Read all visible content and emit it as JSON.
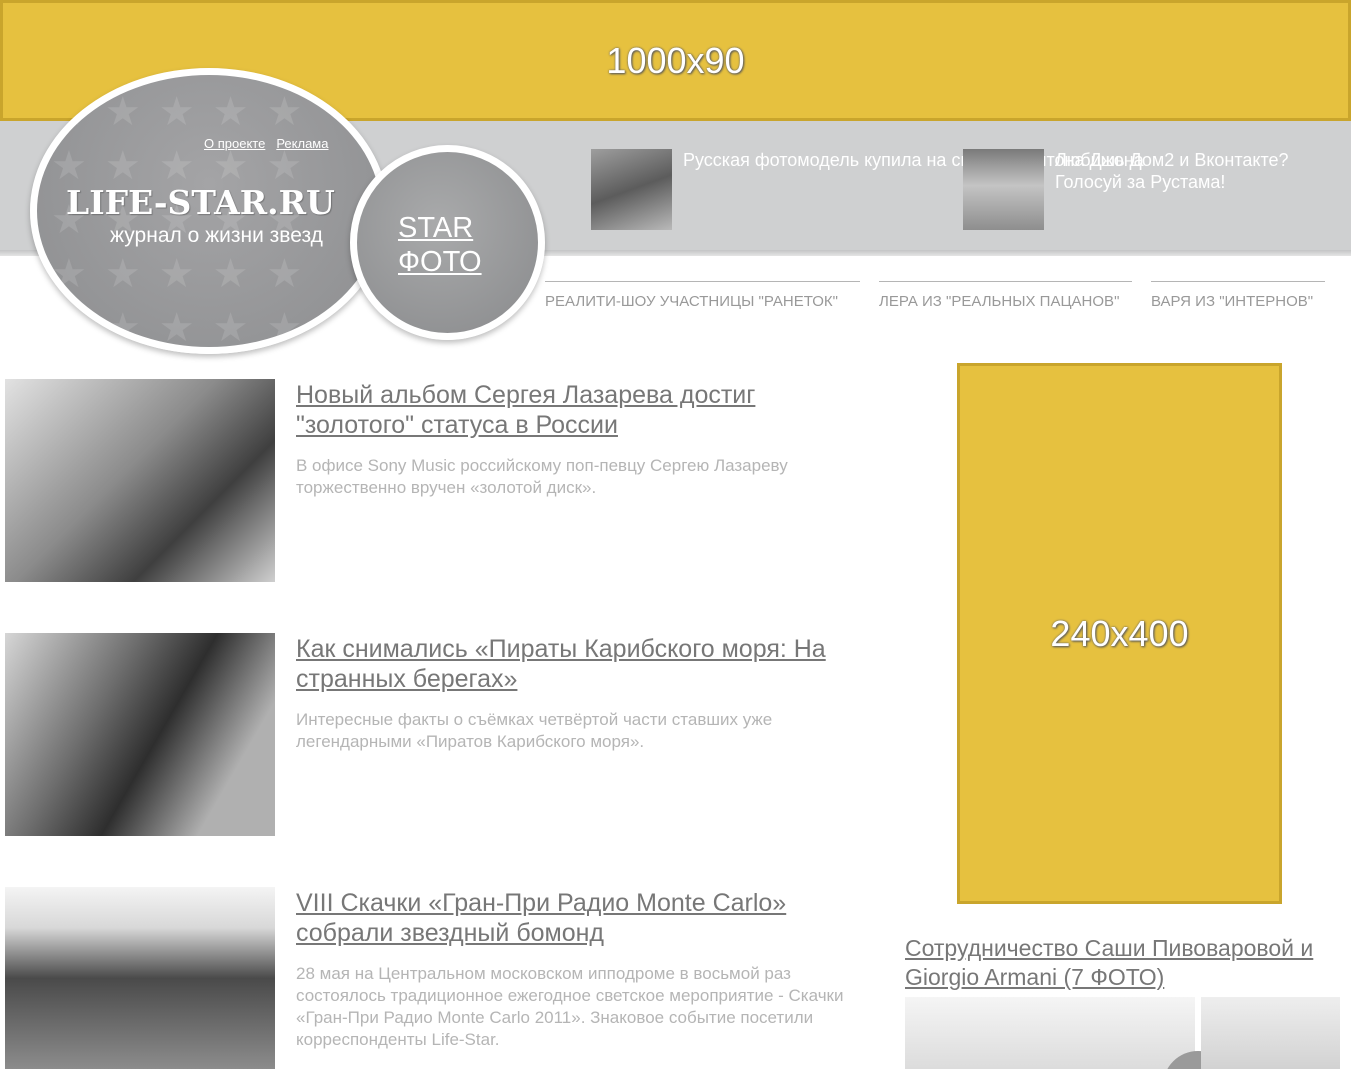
{
  "top_banner": {
    "label": "1000x90"
  },
  "logo": {
    "links": [
      "О проекте",
      "Реклама"
    ],
    "title": "LIFE-STAR.RU",
    "subtitle": "журнал о жизни звезд"
  },
  "star_photo": {
    "line1": "STAR",
    "line2": "ФОТО"
  },
  "teasers": [
    {
      "text": "Русская фотомодель купила на свадьбу Элтона Джона"
    },
    {
      "text": "Любишь Дом2 и Вконтакте? Голосуй за Рустама!"
    }
  ],
  "nav": [
    "РЕАЛИТИ-ШОУ УЧАСТНИЦЫ \"РАНЕТОК\"",
    "ЛЕРА ИЗ \"РЕАЛЬНЫХ ПАЦАНОВ\"",
    "ВАРЯ ИЗ \"ИНТЕРНОВ\""
  ],
  "articles": [
    {
      "title": "Новый альбом Сергея Лазарева достиг \"золотого\" статуса в России",
      "text": "В офисе Sony Music российскому поп-певцу Сергею Лазареву торжественно вручен «золотой диск»."
    },
    {
      "title": "Как снимались «Пираты Карибского моря: На странных берегах»",
      "text": "Интересные факты о съёмках четвёртой части ставших уже легендарными «Пиратов Карибского моря»."
    },
    {
      "title": "VIII Скачки «Гран-При Радио Monte Carlo» собрали звездный бомонд",
      "text": "28 мая на Центральном московском ипподроме в восьмой раз состоялось традиционное ежегодное светское мероприятие - Скачки «Гран-При Радио Monte Carlo 2011». Знаковое событие посетили корреспонденты Life-Star."
    }
  ],
  "side_banner": {
    "label": "240x400"
  },
  "side_article": {
    "title": "Сотрудничество Саши Пивоваровой и Giorgio Armani (7 ФОТО)"
  },
  "colors": {
    "ad_yellow": "#e6c13f",
    "header_gray": "#cfd0d1",
    "circle_gray": "#98999b"
  }
}
